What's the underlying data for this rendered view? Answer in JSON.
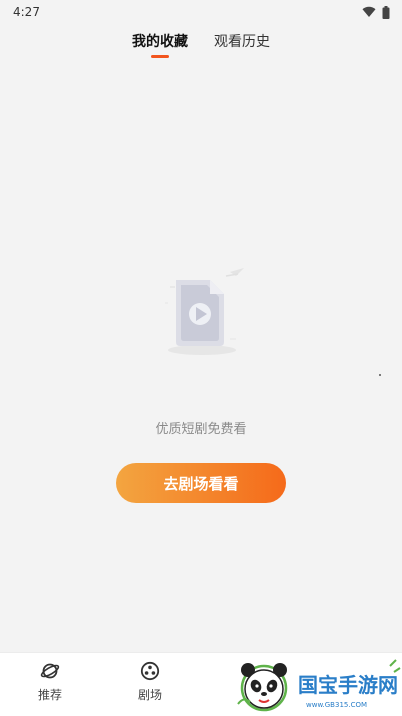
{
  "status_bar": {
    "time": "4:27"
  },
  "tabs": [
    {
      "label": "我的收藏",
      "active": true
    },
    {
      "label": "观看历史",
      "active": false
    }
  ],
  "empty_state": {
    "icon": "video-file-icon",
    "message": "优质短剧免费看",
    "button_label": "去剧场看看"
  },
  "bottom_nav": [
    {
      "label": "推荐",
      "icon": "planet-icon"
    },
    {
      "label": "剧场",
      "icon": "film-reel-icon"
    }
  ],
  "watermark": {
    "brand": "国宝手游网",
    "url": "www.GB315.COM"
  },
  "colors": {
    "accent": "#f2541d",
    "button_gradient_start": "#f3a540",
    "button_gradient_end": "#f56a1a",
    "background": "#f3f3f3"
  }
}
